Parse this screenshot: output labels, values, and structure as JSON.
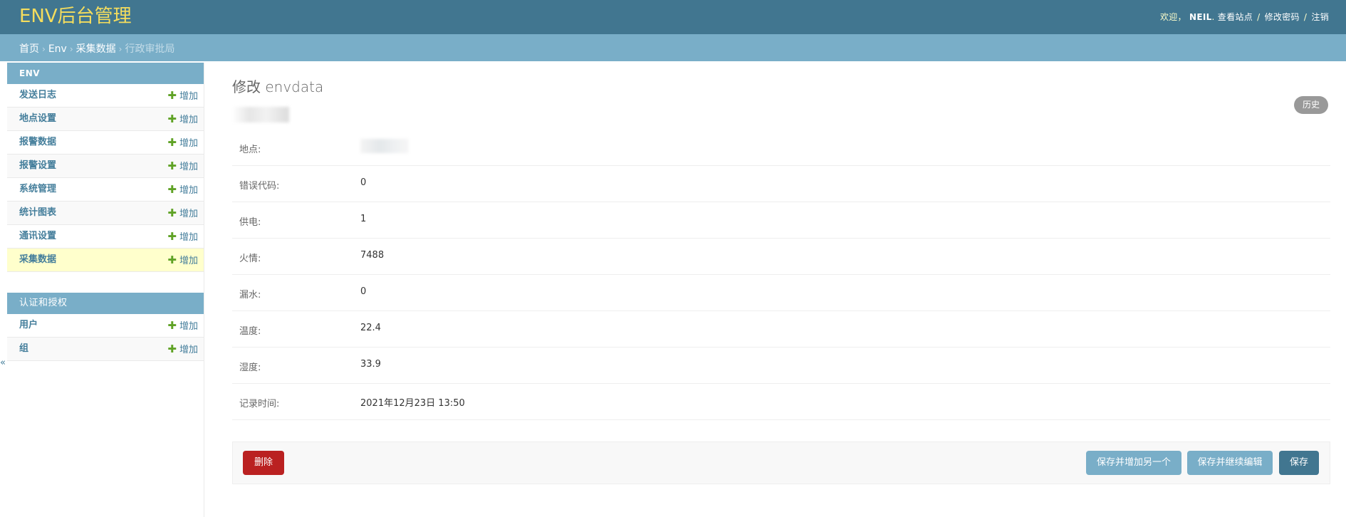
{
  "header": {
    "brand": "ENV后台管理",
    "welcome": "欢迎，",
    "username": "NEIL",
    "links": [
      "查看站点",
      "修改密码",
      "注销"
    ],
    "separator": "/",
    "period": "."
  },
  "breadcrumbs": {
    "items": [
      "首页",
      "Env",
      "采集数据"
    ],
    "current": "行政审批局",
    "separator": "›"
  },
  "sidebar": {
    "toggle": "«",
    "modules": [
      {
        "caption": "ENV",
        "items": [
          {
            "name": "发送日志",
            "add": "增加"
          },
          {
            "name": "地点设置",
            "add": "增加"
          },
          {
            "name": "报警数据",
            "add": "增加"
          },
          {
            "name": "报警设置",
            "add": "增加"
          },
          {
            "name": "系统管理",
            "add": "增加"
          },
          {
            "name": "统计图表",
            "add": "增加"
          },
          {
            "name": "通讯设置",
            "add": "增加"
          },
          {
            "name": "采集数据",
            "add": "增加"
          }
        ]
      },
      {
        "caption": "认证和授权",
        "items": [
          {
            "name": "用户",
            "add": "增加"
          },
          {
            "name": "组",
            "add": "增加"
          }
        ]
      }
    ]
  },
  "content": {
    "title": "修改 envdata",
    "history": "历史",
    "fields": [
      {
        "label": "地点:",
        "value": ""
      },
      {
        "label": "错误代码:",
        "value": "0"
      },
      {
        "label": "供电:",
        "value": "1"
      },
      {
        "label": "火情:",
        "value": "7488"
      },
      {
        "label": "漏水:",
        "value": "0"
      },
      {
        "label": "温度:",
        "value": "22.4"
      },
      {
        "label": "湿度:",
        "value": "33.9"
      },
      {
        "label": "记录时间:",
        "value": "2021年12月23日 13:50"
      }
    ]
  },
  "actions": {
    "delete": "删除",
    "save_add": "保存并增加另一个",
    "save_continue": "保存并继续编辑",
    "save": "保存"
  },
  "colors": {
    "header_bg": "#417690",
    "brand": "#f5dd5d",
    "breadcrumb_bg": "#79aec8",
    "active_row": "#ffffcc",
    "delete": "#ba2121",
    "add_icon": "#5fa225"
  }
}
